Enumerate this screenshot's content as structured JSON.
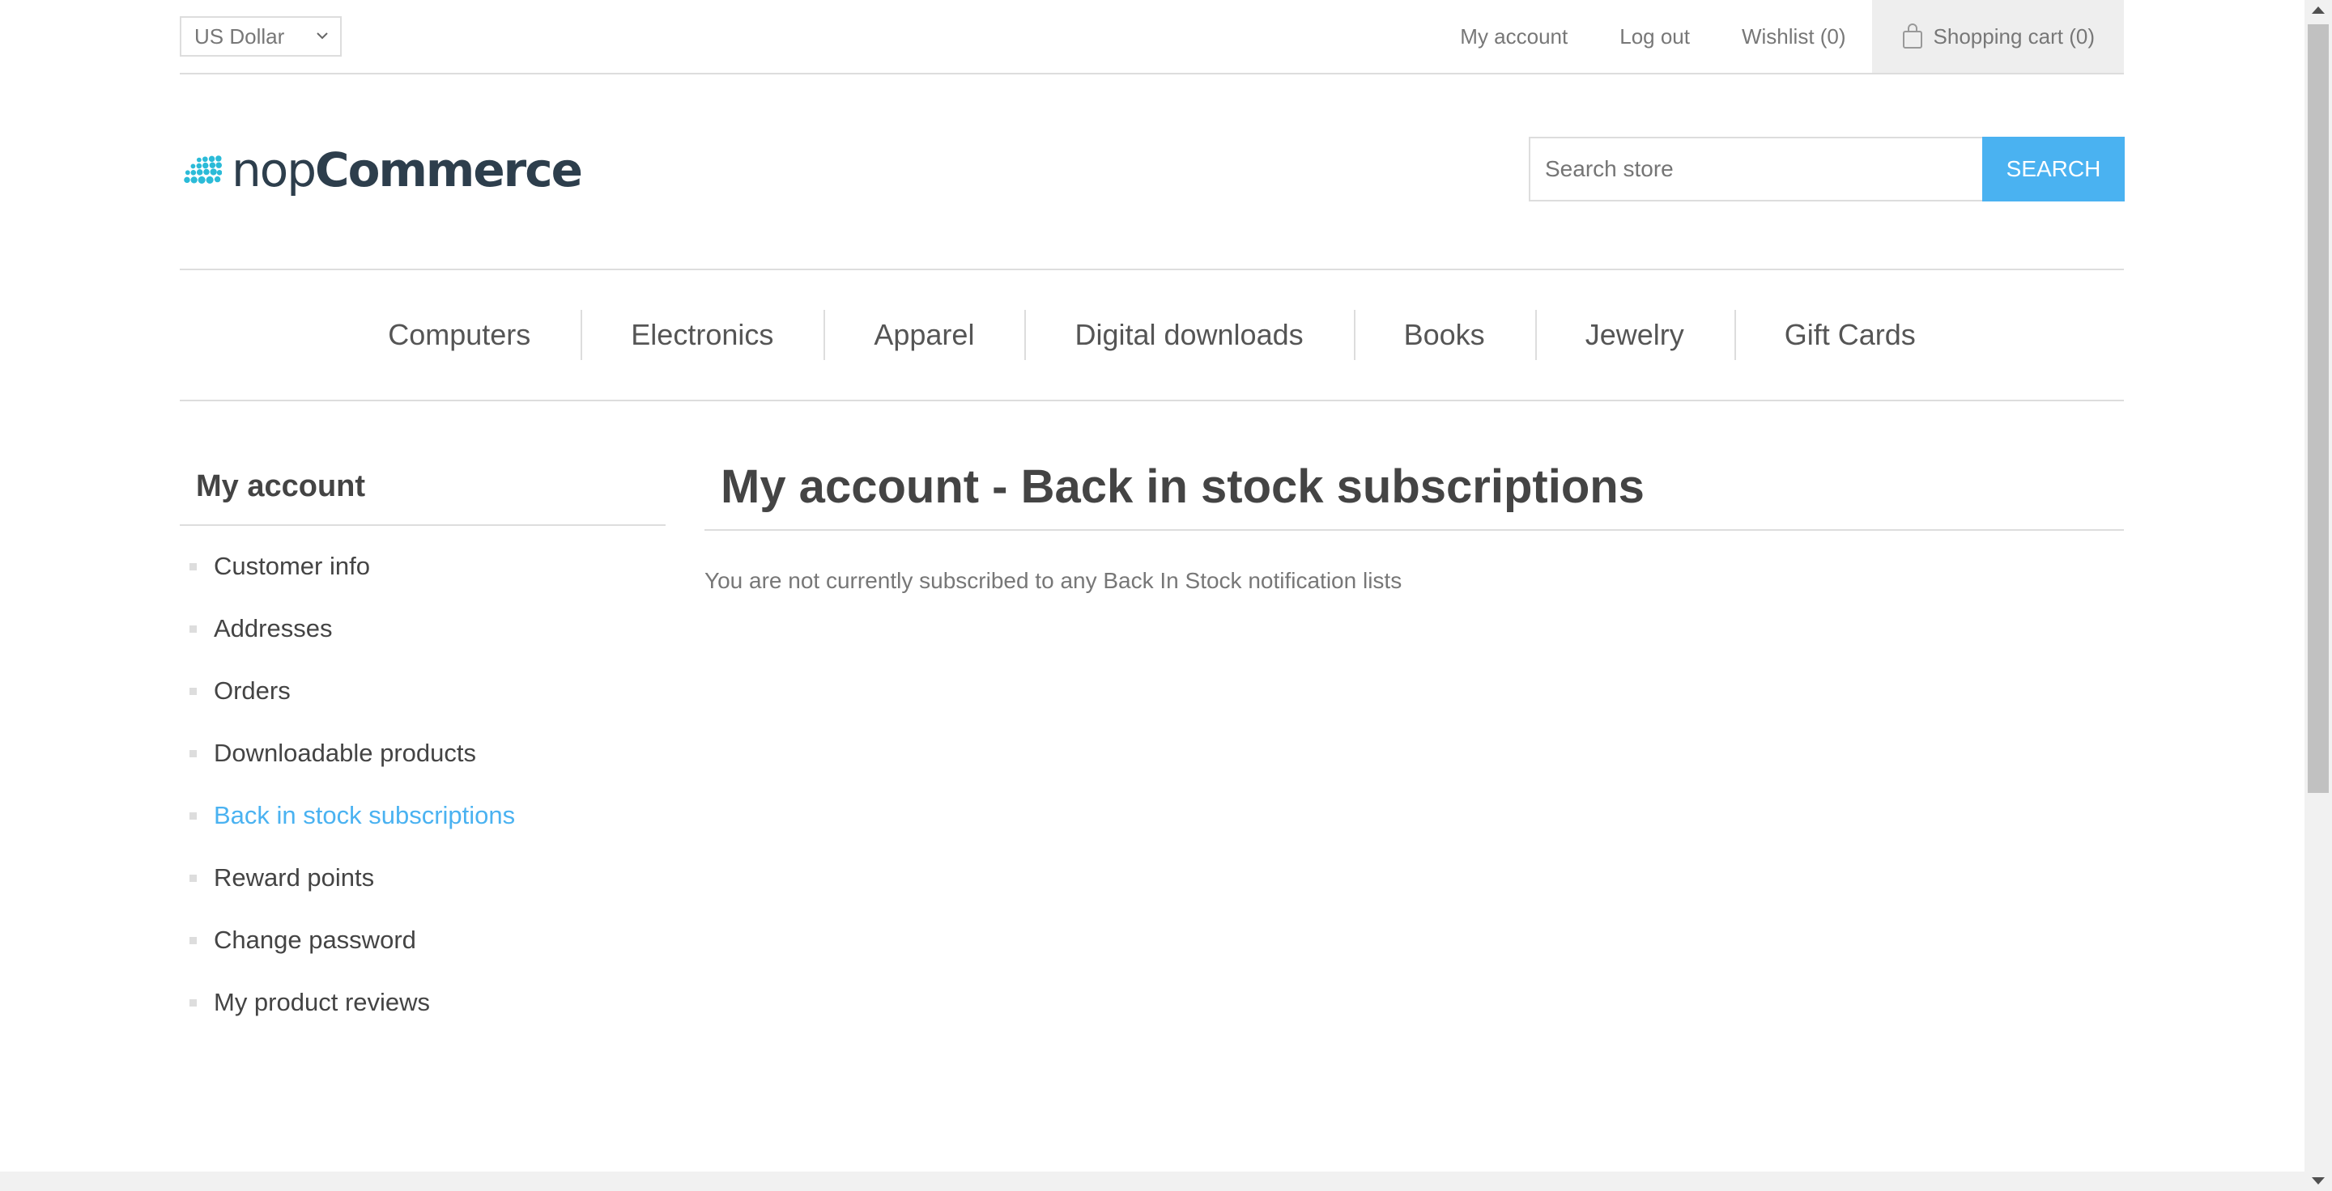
{
  "header": {
    "currency": "US Dollar",
    "links": {
      "my_account": "My account",
      "log_out": "Log out",
      "wishlist": "Wishlist (0)",
      "shopping_cart": "Shopping cart (0)"
    }
  },
  "logo": {
    "text_light": "nop",
    "text_bold": "Commerce",
    "brand_color": "#2bbbd8"
  },
  "search": {
    "placeholder": "Search store",
    "button_label": "SEARCH"
  },
  "menu": {
    "items": [
      "Computers",
      "Electronics",
      "Apparel",
      "Digital downloads",
      "Books",
      "Jewelry",
      "Gift Cards"
    ]
  },
  "side": {
    "title": "My account",
    "items": [
      "Customer info",
      "Addresses",
      "Orders",
      "Downloadable products",
      "Back in stock subscriptions",
      "Reward points",
      "Change password",
      "My product reviews"
    ],
    "active_index": 4
  },
  "main": {
    "title": "My account - Back in stock subscriptions",
    "notice": "You are not currently subscribed to any Back In Stock notification lists"
  },
  "colors": {
    "accent": "#4ab2f1",
    "border": "#dddddd",
    "text": "#444444",
    "muted": "#777777"
  }
}
